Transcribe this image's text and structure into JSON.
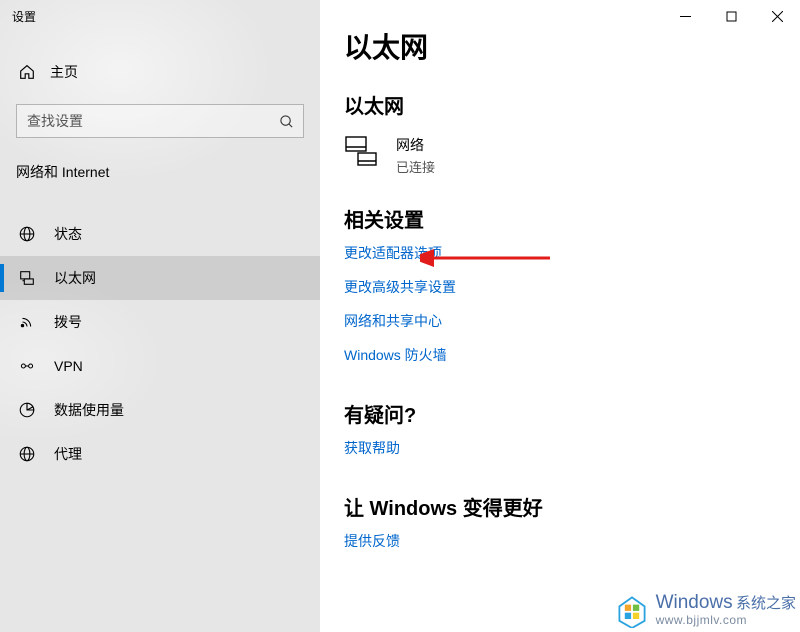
{
  "window": {
    "title": "设置"
  },
  "sidebar": {
    "home_label": "主页",
    "search_placeholder": "查找设置",
    "section_label": "网络和 Internet",
    "items": [
      {
        "label": "状态"
      },
      {
        "label": "以太网"
      },
      {
        "label": "拨号"
      },
      {
        "label": "VPN"
      },
      {
        "label": "数据使用量"
      },
      {
        "label": "代理"
      }
    ]
  },
  "content": {
    "page_title": "以太网",
    "network_section_title": "以太网",
    "network": {
      "name": "网络",
      "status": "已连接"
    },
    "related_title": "相关设置",
    "links": [
      "更改适配器选项",
      "更改高级共享设置",
      "网络和共享中心",
      "Windows 防火墙"
    ],
    "help_title": "有疑问?",
    "help_link": "获取帮助",
    "feedback_title": "让 Windows 变得更好",
    "feedback_link": "提供反馈"
  },
  "watermark": {
    "brand": "Windows",
    "brand_suffix": "系统之家",
    "url": "www.bjjmlv.com"
  }
}
